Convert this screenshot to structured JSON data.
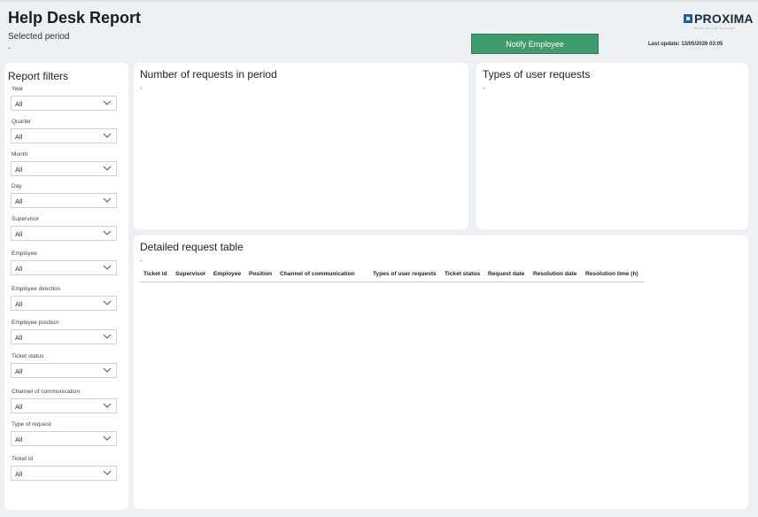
{
  "header": {
    "title": "Help Desk Report",
    "subtitle": "Selected period",
    "period_value": "-",
    "notify_label": "Notify Employee",
    "last_update": "Last update: 13/05/2026 03:05",
    "logo_text": "PROXIMA",
    "logo_tagline": "DEVELOP FOR SUCCESS"
  },
  "filters": {
    "title": "Report filters",
    "items": [
      {
        "label": "Year",
        "value": "All"
      },
      {
        "label": "Quarter",
        "value": "All"
      },
      {
        "label": "Month",
        "value": "All"
      },
      {
        "label": "Day",
        "value": "All"
      },
      {
        "label": "Supervisor",
        "value": "All"
      },
      {
        "label": "Employee",
        "value": "All"
      },
      {
        "label": "Employee direction",
        "value": "All"
      },
      {
        "label": "Employee position",
        "value": "All"
      },
      {
        "label": "Ticket status",
        "value": "All"
      },
      {
        "label": "Channel of communication",
        "value": "All"
      },
      {
        "label": "Type of request",
        "value": "All"
      },
      {
        "label": "Ticket id",
        "value": "All"
      }
    ]
  },
  "requests_card": {
    "title": "Number of requests in period",
    "value": "-"
  },
  "types_card": {
    "title": "Types of user requests",
    "value": "-"
  },
  "table_card": {
    "title": "Detailed request table",
    "value": "-",
    "columns": [
      "Ticket id",
      "Supervisor",
      "Employee",
      "Position",
      "Channel of communication",
      "Types of user requests",
      "Ticket status",
      "Request date",
      "Resolution date",
      "Resolution time (h)"
    ]
  },
  "colors": {
    "accent": "#3f9a6d",
    "background": "#edf1f4",
    "card": "#ffffff"
  },
  "icons": {
    "dropdown": "chevron-down-icon",
    "logo": "proxima-logo-icon"
  }
}
